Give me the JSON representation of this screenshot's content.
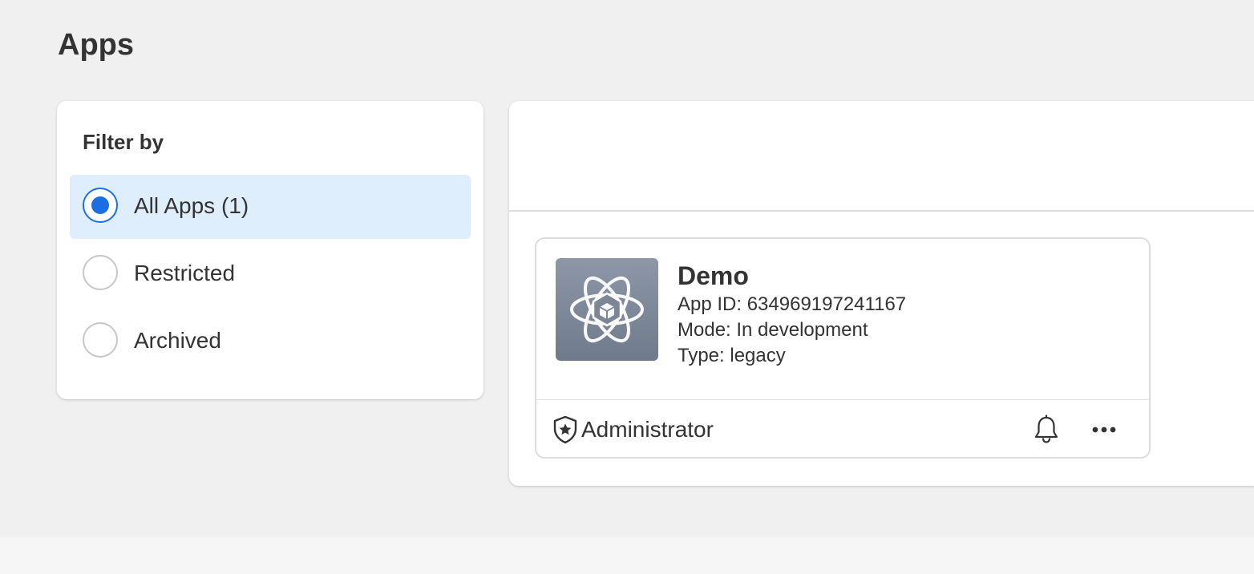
{
  "page": {
    "title": "Apps"
  },
  "filter": {
    "heading": "Filter by",
    "options": [
      {
        "label": "All Apps (1)",
        "selected": true
      },
      {
        "label": "Restricted",
        "selected": false
      },
      {
        "label": "Archived",
        "selected": false
      }
    ]
  },
  "app_card": {
    "name": "Demo",
    "app_id": "App ID: 634969197241167",
    "mode": "Mode: In development",
    "type": "Type: legacy",
    "icon": "atom-cube-icon",
    "role": {
      "icon": "shield-star-icon",
      "label": "Administrator"
    },
    "actions": {
      "notifications_icon": "bell-icon",
      "more_icon": "more-horizontal-icon"
    }
  },
  "colors": {
    "accent": "#1b6fe3",
    "selected_bg": "#dfeefd",
    "page_bg": "#f0f0f0"
  }
}
